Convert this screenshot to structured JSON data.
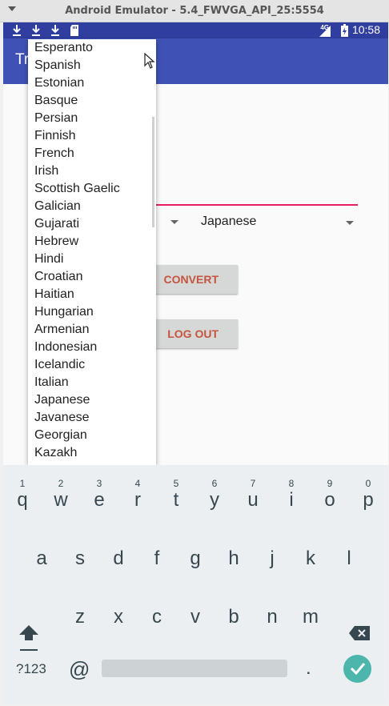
{
  "window": {
    "title": "Android Emulator - 5.4_FWVGA_API_25:5554"
  },
  "status_bar": {
    "icons": [
      "download-icon",
      "download-icon",
      "download-icon",
      "sd-card-icon"
    ],
    "network": "4G",
    "time": "10:58"
  },
  "app_bar": {
    "title_visible": "Tr"
  },
  "spinner_target": {
    "selected": "Japanese"
  },
  "buttons": {
    "convert": "CONVERT",
    "logout": "LOG OUT"
  },
  "dropdown": {
    "items": [
      "Esperanto",
      "Spanish",
      "Estonian",
      "Basque",
      "Persian",
      "Finnish",
      "French",
      "Irish",
      "Scottish Gaelic",
      "Galician",
      "Gujarati",
      "Hebrew",
      "Hindi",
      "Croatian",
      "Haitian",
      "Hungarian",
      "Armenian",
      "Indonesian",
      "Icelandic",
      "Italian",
      "Japanese",
      "Javanese",
      "Georgian",
      "Kazakh"
    ]
  },
  "keyboard": {
    "row1": [
      {
        "hint": "1",
        "key": "q"
      },
      {
        "hint": "2",
        "key": "w"
      },
      {
        "hint": "3",
        "key": "e"
      },
      {
        "hint": "4",
        "key": "r"
      },
      {
        "hint": "5",
        "key": "t"
      },
      {
        "hint": "6",
        "key": "y"
      },
      {
        "hint": "7",
        "key": "u"
      },
      {
        "hint": "8",
        "key": "i"
      },
      {
        "hint": "9",
        "key": "o"
      },
      {
        "hint": "0",
        "key": "p"
      }
    ],
    "row2": [
      "a",
      "s",
      "d",
      "f",
      "g",
      "h",
      "j",
      "k",
      "l"
    ],
    "row3": [
      "z",
      "x",
      "c",
      "v",
      "b",
      "n",
      "m"
    ],
    "symbols_key": "?123",
    "at_key": "@",
    "period_key": ".",
    "accent_color": "#4db6ac"
  }
}
